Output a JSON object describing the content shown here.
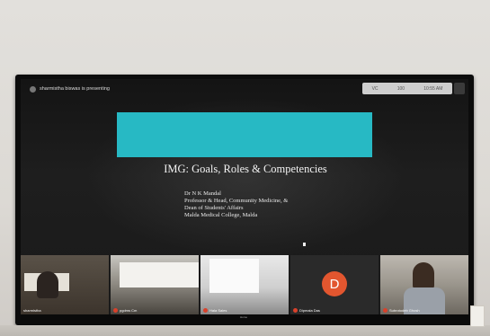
{
  "meeting": {
    "presenter_label": "sharmistha biswas is presenting",
    "controls": [
      "VC",
      "100",
      "10:55 AM"
    ]
  },
  "slide": {
    "accent_color": "#27b9c4",
    "title": "IMG: Goals, Roles & Competencies",
    "speaker_lines": [
      "Dr N K Mandal",
      "Professor & Head, Community Medicine, &",
      "Dean of Students' Affairs",
      "Malda Medical College, Malda"
    ]
  },
  "participants": [
    {
      "name": "sharmistha",
      "video": "camera"
    },
    {
      "name": "pgdms Cm",
      "video": "classroom"
    },
    {
      "name": "Hala Sales",
      "video": "screen"
    },
    {
      "name": "Dipmala Das",
      "video": "avatar",
      "initial": "D"
    },
    {
      "name": "Subrotodeb Ghosh",
      "video": "camera"
    }
  ],
  "bottom_bar_text": "Home"
}
